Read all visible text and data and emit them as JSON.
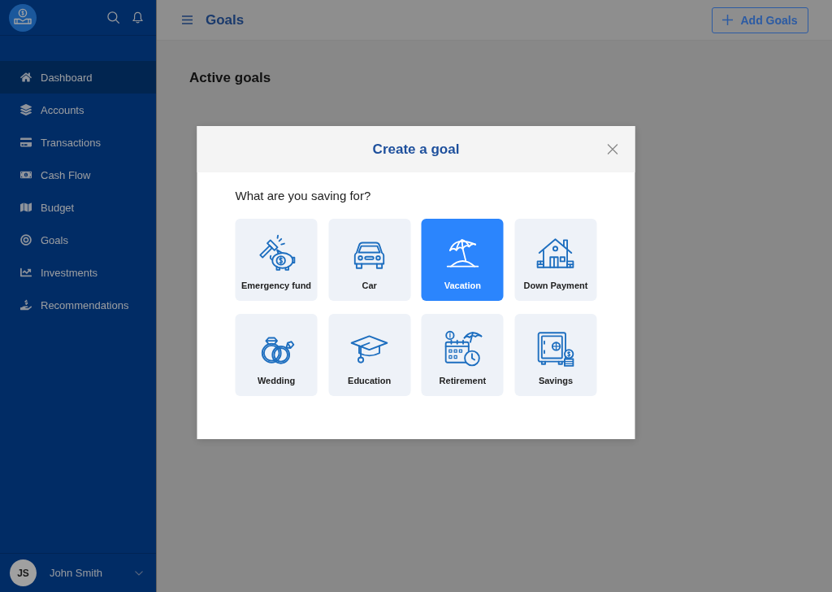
{
  "sidebar": {
    "items": [
      {
        "label": "Dashboard",
        "selected": true
      },
      {
        "label": "Accounts",
        "selected": false
      },
      {
        "label": "Transactions",
        "selected": false
      },
      {
        "label": "Cash Flow",
        "selected": false
      },
      {
        "label": "Budget",
        "selected": false
      },
      {
        "label": "Goals",
        "selected": false
      },
      {
        "label": "Investments",
        "selected": false
      },
      {
        "label": "Recommendations",
        "selected": false
      }
    ],
    "user": {
      "initials": "JS",
      "name": "John Smith"
    }
  },
  "header": {
    "title": "Goals",
    "add_button": "Add Goals"
  },
  "content": {
    "section_title": "Active goals"
  },
  "modal": {
    "title": "Create a goal",
    "question": "What are you saving for?",
    "options": [
      {
        "label": "Emergency fund",
        "selected": false
      },
      {
        "label": "Car",
        "selected": false
      },
      {
        "label": "Vacation",
        "selected": true
      },
      {
        "label": "Down Payment",
        "selected": false
      },
      {
        "label": "Wedding",
        "selected": false
      },
      {
        "label": "Education",
        "selected": false
      },
      {
        "label": "Retirement",
        "selected": false
      },
      {
        "label": "Savings",
        "selected": false
      }
    ]
  }
}
